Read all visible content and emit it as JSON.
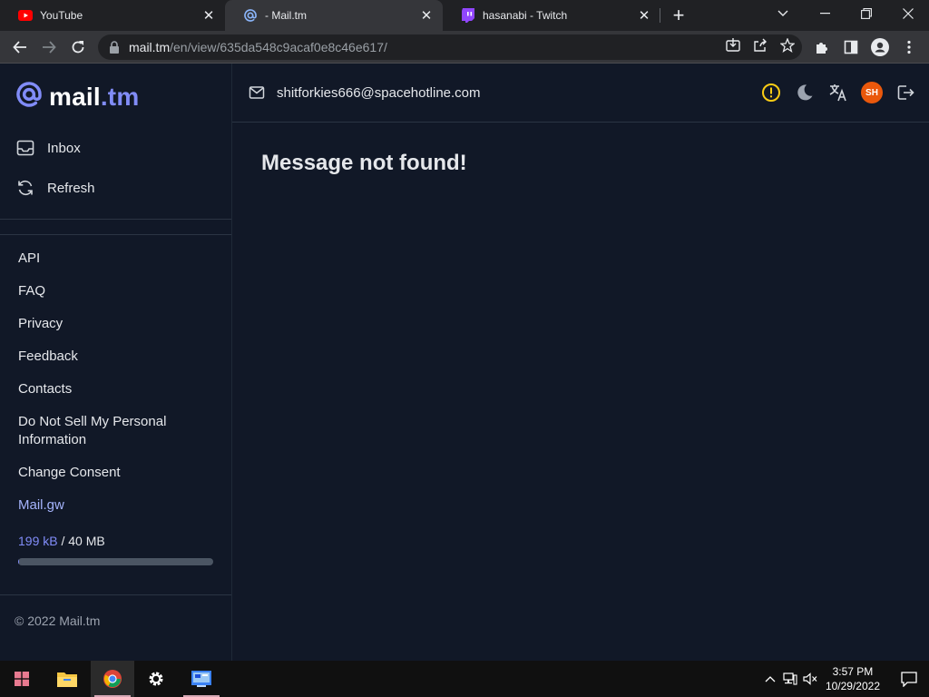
{
  "browser": {
    "tabs": [
      {
        "title": "YouTube",
        "icon": "youtube-icon",
        "color": "#ff0000"
      },
      {
        "title": "- Mail.tm",
        "icon": "mailtm-at-icon",
        "color": "#818cf8"
      },
      {
        "title": "hasanabi - Twitch",
        "icon": "twitch-icon",
        "color": "#9146ff"
      }
    ],
    "url_host": "mail.tm",
    "url_path": "/en/view/635da548c9acaf0e8c46e617/"
  },
  "app": {
    "logo": {
      "name": "mail",
      "tld": ".tm",
      "accent": "#818cf8"
    },
    "nav": [
      {
        "label": "Inbox",
        "icon": "inbox-icon"
      },
      {
        "label": "Refresh",
        "icon": "refresh-icon"
      }
    ],
    "links": [
      {
        "label": "API"
      },
      {
        "label": "FAQ"
      },
      {
        "label": "Privacy"
      },
      {
        "label": "Feedback"
      },
      {
        "label": "Contacts"
      },
      {
        "label": "Do Not Sell My Personal Information"
      },
      {
        "label": "Change Consent"
      },
      {
        "label": "Mail.gw"
      }
    ],
    "quota": {
      "used": "199 kB",
      "total": "/ 40 MB",
      "fraction": 0.005
    },
    "copyright": "© 2022 Mail.tm",
    "account_email": "shitforkies666@spacehotline.com",
    "avatar_initials": "SH",
    "message": "Message not found!"
  },
  "taskbar": {
    "time": "3:57 PM",
    "date": "10/29/2022"
  }
}
